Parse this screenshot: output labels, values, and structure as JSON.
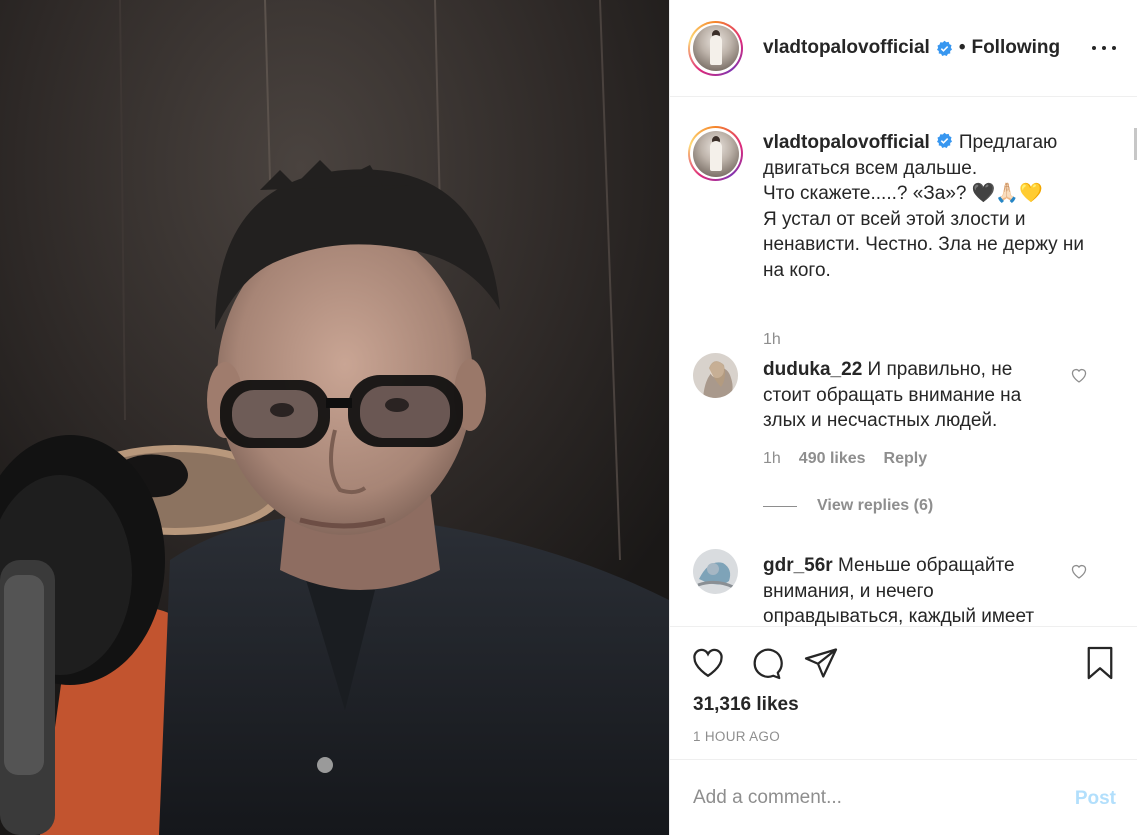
{
  "post": {
    "author": "vladtopalovofficial",
    "separator": "•",
    "follow_status": "Following",
    "more_label": "More options"
  },
  "caption": {
    "username": "vladtopalovofficial",
    "text_line1": "Предлагаю",
    "text_rest": "двигаться всем дальше.",
    "line2": "Что скажете.....? «За»? 🖤🙏🏻💛",
    "line3": "Я устал от всей этой злости и",
    "line4": "ненависти. Честно. Зла не держу ни",
    "line5": "на кого.",
    "time": "1h"
  },
  "comments": [
    {
      "username": "duduka_22",
      "text": "И правильно, не стоит обращать внимание на злых и несчастных людей.",
      "line1": "И правильно, не",
      "line2": "стоит обращать внимание на",
      "line3": "злых и несчастных людей.",
      "time": "1h",
      "likes": "490 likes",
      "reply": "Reply",
      "view_replies": "View replies (6)"
    },
    {
      "username": "gdr_56r",
      "line1": "Меньше обращайте",
      "line2": "внимания, и нечего",
      "line3": "оправдываться, каждый имеет"
    }
  ],
  "actions": {
    "likes": "31,316 likes",
    "time_ago": "1 HOUR AGO"
  },
  "add_comment": {
    "placeholder": "Add a comment...",
    "post_label": "Post"
  },
  "colors": {
    "link_blue": "#0095f6",
    "post_disabled": "#b2dffc",
    "verified_blue": "#3897f0",
    "muted": "#8e8e8e"
  }
}
